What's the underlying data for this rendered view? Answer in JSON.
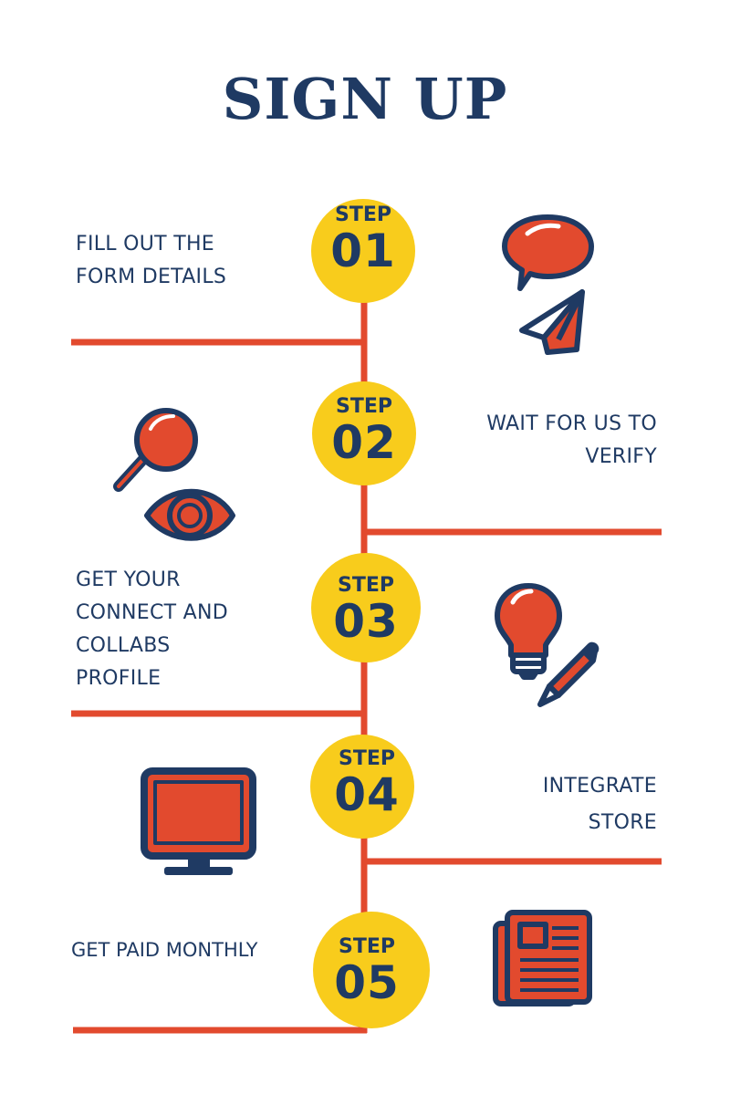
{
  "title": "SIGN UP",
  "colors": {
    "navy": "#1f3a63",
    "orange": "#e24a2e",
    "yellow": "#f8cc1c",
    "white": "#ffffff"
  },
  "steps": [
    {
      "word": "STEP",
      "num": "01",
      "lines": [
        "FILL OUT THE",
        "FORM DETAILS"
      ],
      "icon": "speech-bubble-paper-plane-icon"
    },
    {
      "word": "STEP",
      "num": "02",
      "lines": [
        "WAIT FOR US TO",
        "VERIFY"
      ],
      "icon": "magnifier-eye-icon"
    },
    {
      "word": "STEP",
      "num": "03",
      "lines": [
        "GET YOUR",
        "CONNECT AND",
        "COLLABS",
        "PROFILE"
      ],
      "icon": "lightbulb-pencil-icon"
    },
    {
      "word": "STEP",
      "num": "04",
      "lines": [
        "INTEGRATE",
        "STORE"
      ],
      "icon": "monitor-icon"
    },
    {
      "word": "STEP",
      "num": "05",
      "lines": [
        "GET PAID MONTHLY"
      ],
      "icon": "newspaper-icon"
    }
  ]
}
